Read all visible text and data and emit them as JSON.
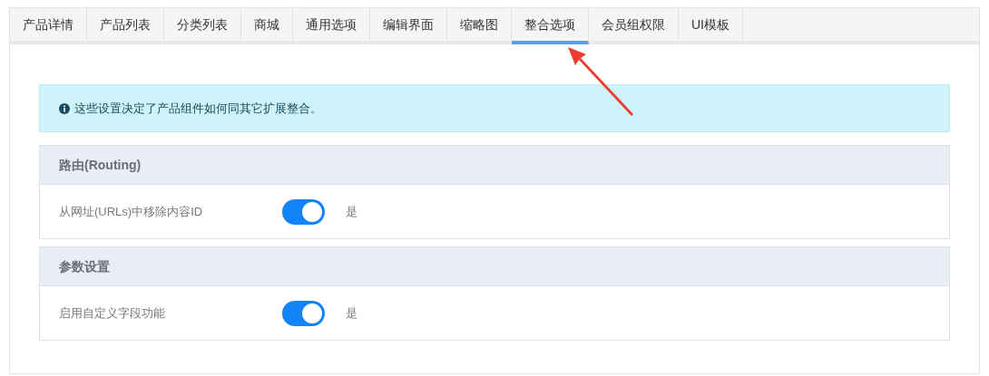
{
  "tabs": [
    {
      "label": "产品详情",
      "selected": false
    },
    {
      "label": "产品列表",
      "selected": false
    },
    {
      "label": "分类列表",
      "selected": false
    },
    {
      "label": "商城",
      "selected": false
    },
    {
      "label": "通用选项",
      "selected": false
    },
    {
      "label": "编辑界面",
      "selected": false
    },
    {
      "label": "缩略图",
      "selected": false
    },
    {
      "label": "整合选项",
      "selected": true
    },
    {
      "label": "会员组权限",
      "selected": false
    },
    {
      "label": "UI模板",
      "selected": false
    }
  ],
  "info": {
    "text": "这些设置决定了产品组件如何同其它扩展整合。"
  },
  "sections": [
    {
      "title": "路由(Routing)",
      "fields": [
        {
          "label": "从网址(URLs)中移除内容ID",
          "on": true,
          "value": "是"
        }
      ]
    },
    {
      "title": "参数设置",
      "fields": [
        {
          "label": "启用自定义字段功能",
          "on": true,
          "value": "是"
        }
      ]
    }
  ]
}
